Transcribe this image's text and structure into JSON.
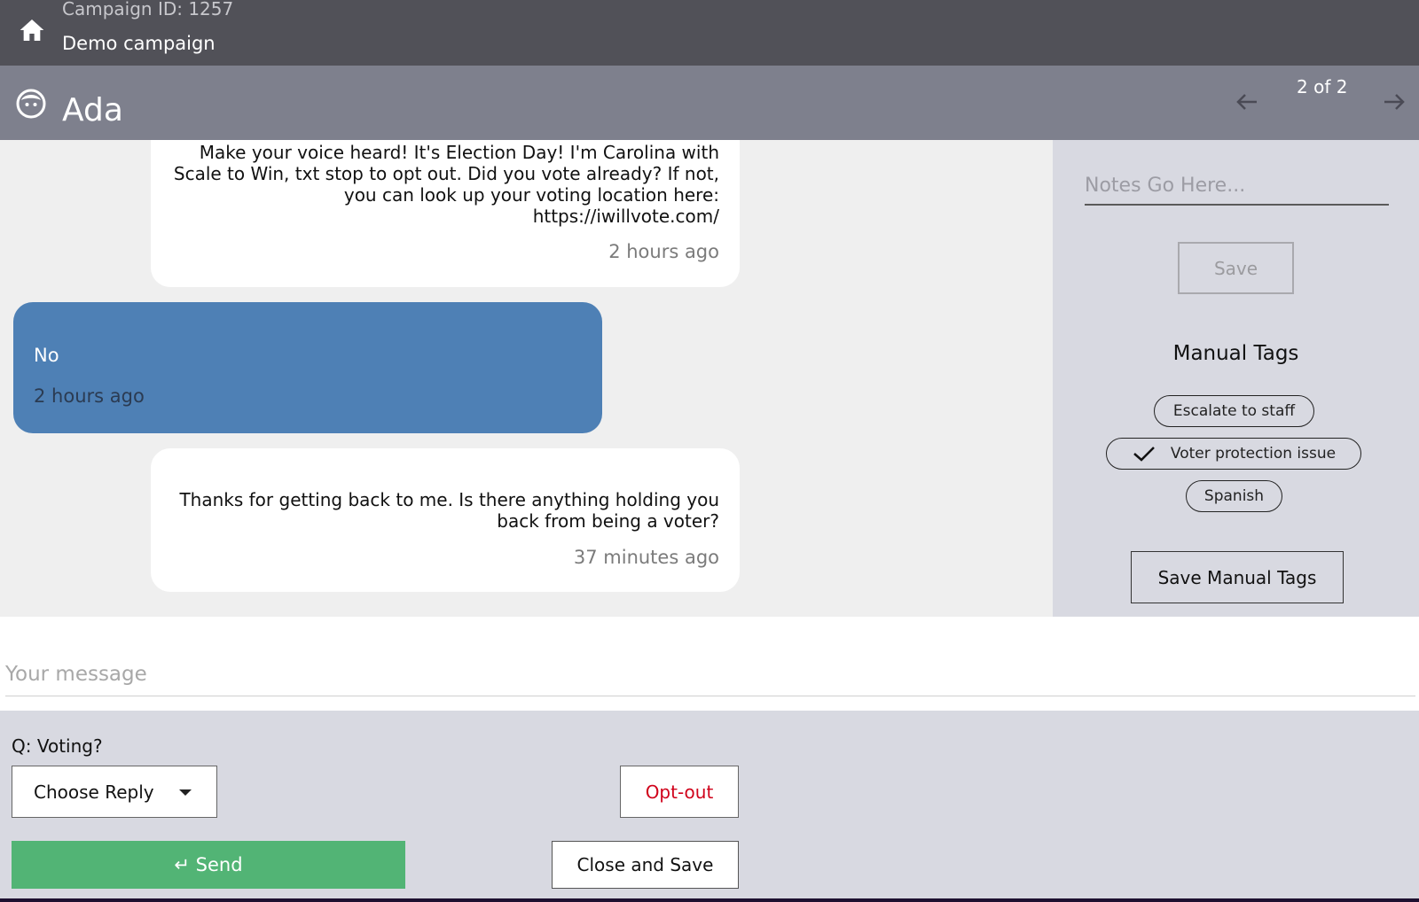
{
  "header": {
    "campaign_id": "Campaign ID: 1257",
    "campaign_name": "Demo campaign",
    "home_icon": "home-icon"
  },
  "contact": {
    "name": "Ada",
    "avatar_icon": "face-icon",
    "pager": "2 of 2"
  },
  "messages": [
    {
      "direction": "outgoing",
      "lines": [
        "Make your voice heard! It's Election Day! I'm Carolina with",
        "Scale to Win, txt stop to opt out. Did you vote already? If not,",
        "you can look up your voting location here:",
        "https://iwillvote.com/"
      ],
      "time": "2 hours ago"
    },
    {
      "direction": "incoming",
      "lines": [
        "No"
      ],
      "time": "2 hours ago"
    },
    {
      "direction": "outgoing",
      "lines": [
        "Thanks for getting back to me. Is there anything holding you",
        "back from being a voter?"
      ],
      "time": "37 minutes ago"
    }
  ],
  "side_panel": {
    "notes_placeholder": "Notes Go Here...",
    "save_label": "Save",
    "tags_title": "Manual Tags",
    "tags": [
      {
        "label": "Escalate to staff",
        "checked": false
      },
      {
        "label": "Voter protection issue",
        "checked": true
      },
      {
        "label": "Spanish",
        "checked": false
      }
    ],
    "save_tags_label": "Save Manual Tags"
  },
  "composer": {
    "placeholder": "Your message"
  },
  "actions": {
    "question": "Q: Voting?",
    "choose_reply": "Choose Reply",
    "opt_out": "Opt-out",
    "send": "↵ Send",
    "close_save": "Close and Save"
  },
  "colors": {
    "header_bg": "#515158",
    "contact_bar_bg": "#7e808d",
    "incoming_bubble": "#4e80b5",
    "send_button": "#52b475",
    "opt_out_text": "#d0021b"
  }
}
